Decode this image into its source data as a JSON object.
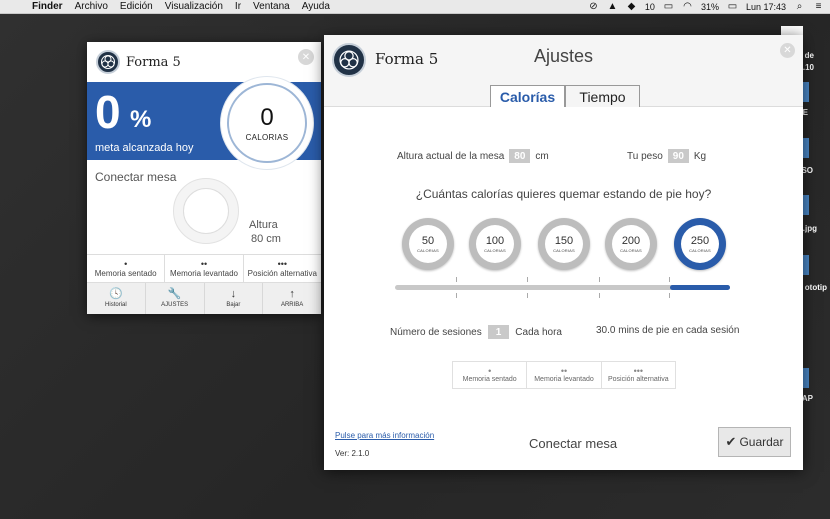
{
  "menubar": {
    "items": [
      "Finder",
      "Archivo",
      "Edición",
      "Visualización",
      "Ir",
      "Ventana",
      "Ayuda"
    ],
    "status": {
      "icon_count": "10",
      "battery": "31%",
      "clock": "Lun 17:43"
    }
  },
  "desktop": {
    "labels": [
      "de",
      "19.10",
      "E",
      "SO",
      ".jpg",
      "ototip",
      "AP"
    ]
  },
  "small_window": {
    "brand": "Forma 5",
    "percent_value": "0",
    "percent_sign": "%",
    "goal_label": "meta alcanzada hoy",
    "calories_value": "0",
    "calories_label": "CALORIAS",
    "connect_label": "Conectar mesa",
    "height_label": "Altura",
    "height_value": "80 cm",
    "memory": [
      {
        "dots": "•",
        "label": "Memoria sentado"
      },
      {
        "dots": "••",
        "label": "Memoria levantado"
      },
      {
        "dots": "•••",
        "label": "Posición alternativa"
      }
    ],
    "nav": [
      {
        "icon": "history-icon",
        "glyph": "🕓",
        "label": "Historial"
      },
      {
        "icon": "wrench-icon",
        "glyph": "🔧",
        "label": "AJUSTES"
      },
      {
        "icon": "arrow-down-icon",
        "glyph": "↓",
        "label": "Bajar"
      },
      {
        "icon": "arrow-up-icon",
        "glyph": "↑",
        "label": "ARRIBA"
      }
    ]
  },
  "main_window": {
    "brand": "Forma 5",
    "title": "Ajustes",
    "tabs": [
      {
        "label": "Calorías",
        "active": true
      },
      {
        "label": "Tiempo",
        "active": false
      }
    ],
    "table_height_label": "Altura actual de la mesa",
    "table_height_value": "80",
    "table_height_unit": "cm",
    "weight_label": "Tu peso",
    "weight_value": "90",
    "weight_unit": "Kg",
    "question": "¿Cuántas calorías quieres quemar estando de pie hoy?",
    "calorie_options": [
      {
        "value": "50",
        "label": "CALORIAS",
        "selected": false
      },
      {
        "value": "100",
        "label": "CALORIAS",
        "selected": false
      },
      {
        "value": "150",
        "label": "CALORIAS",
        "selected": false
      },
      {
        "value": "200",
        "label": "CALORIAS",
        "selected": false
      },
      {
        "value": "250",
        "label": "CALORIAS",
        "selected": true
      }
    ],
    "sessions_label": "Número de sesiones",
    "sessions_value": "1",
    "sessions_suffix": "Cada hora",
    "session_info": "30.0 mins de pie en cada sesión",
    "memory": [
      {
        "dots": "•",
        "label": "Memoria sentado"
      },
      {
        "dots": "••",
        "label": "Memoria levantado"
      },
      {
        "dots": "•••",
        "label": "Posición alternativa"
      }
    ],
    "info_link": "Pulse para más información",
    "version": "Ver: 2.1.0",
    "connect_label": "Conectar mesa",
    "save_label": "Guardar"
  },
  "colors": {
    "accent": "#2a5caa",
    "value_box": "#c9c9c9"
  }
}
